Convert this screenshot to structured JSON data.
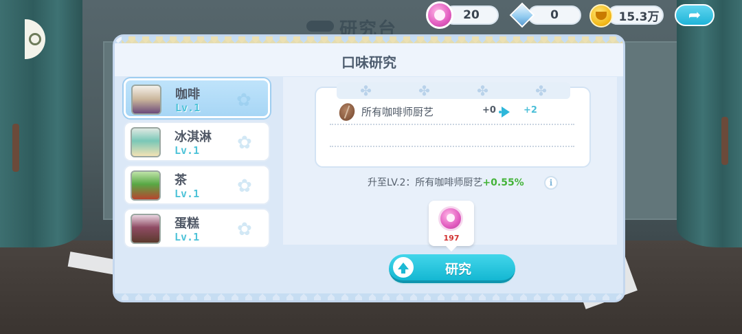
{
  "background": {
    "title": "研究台"
  },
  "hud": {
    "medals": "20",
    "crystals": "0",
    "coins": "15.3万",
    "icons": [
      "medal-icon",
      "crystal-trophy-icon",
      "coin-icon",
      "share-arrow-icon"
    ]
  },
  "panel": {
    "title": "口味研究"
  },
  "categories": [
    {
      "name": "咖啡",
      "level": "Lv.1",
      "icon": "coffee-thumbnail",
      "active": true
    },
    {
      "name": "冰淇淋",
      "level": "Lv.1",
      "icon": "ice-cream-thumbnail",
      "active": false
    },
    {
      "name": "茶",
      "level": "Lv.1",
      "icon": "tea-thumbnail",
      "active": false
    },
    {
      "name": "蛋糕",
      "level": "Lv.1",
      "icon": "cake-thumbnail",
      "active": false
    }
  ],
  "detail": {
    "bonus_label": "所有咖啡师厨艺",
    "bonus_from": "+0",
    "bonus_to": "+2",
    "upgrade_prefix": "升至LV.2：所有咖啡师厨艺",
    "upgrade_pct": "+0.55%",
    "info_label": "i",
    "cost": "197",
    "research_label": "研究"
  },
  "colors": {
    "accent": "#1cb9d4",
    "panel_bg": "#dbe8f7",
    "cost_red": "#d23030",
    "green_pct": "#44b339"
  }
}
